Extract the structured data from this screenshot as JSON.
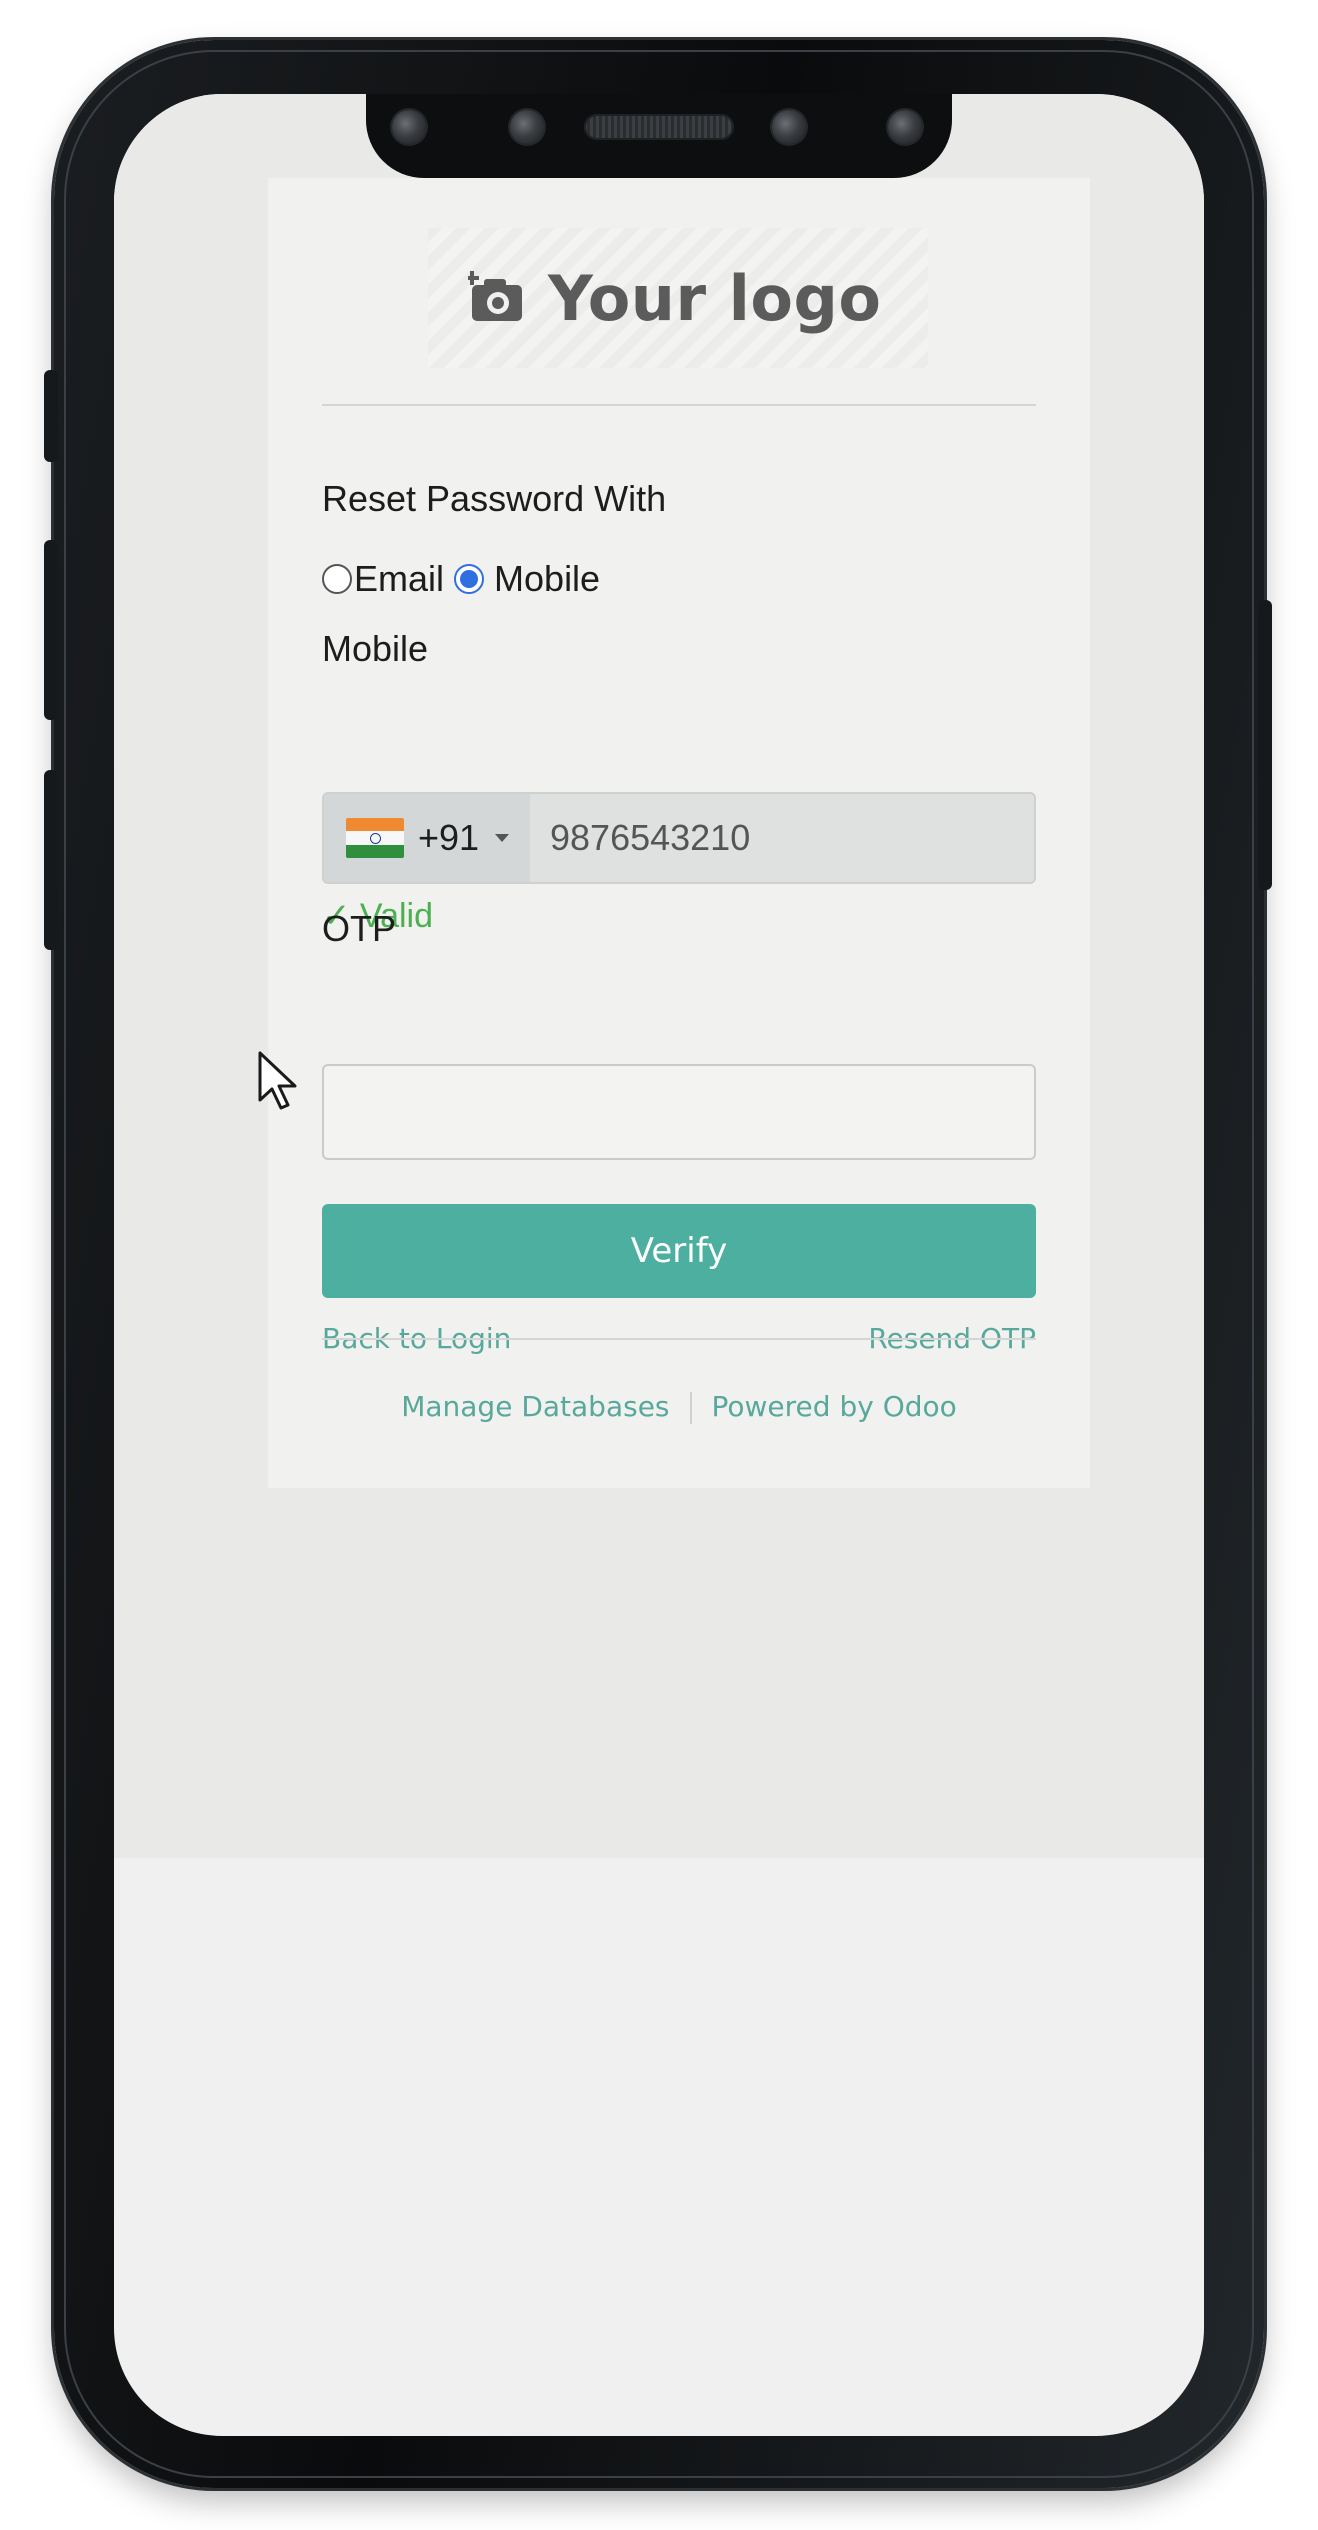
{
  "logo": {
    "text": "Your logo",
    "icon": "camera-icon"
  },
  "form": {
    "reset_label": "Reset Password With",
    "options": [
      {
        "label": "Email",
        "checked": false
      },
      {
        "label": "Mobile",
        "checked": true
      }
    ],
    "mobile_label": "Mobile",
    "country": {
      "flag": "india-flag-icon",
      "dial_code": "+91"
    },
    "mobile_value": "9876543210",
    "validation_text": "✓ Valid",
    "otp_label": "OTP",
    "otp_value": "",
    "verify_label": "Verify",
    "back_link": "Back to Login",
    "resend_link": "Resend OTP"
  },
  "footer": {
    "manage_databases": "Manage Databases",
    "powered_by": "Powered by Odoo"
  },
  "colors": {
    "accent": "#4caf9f",
    "link": "#58a89c",
    "valid": "#4caf50",
    "radio_checked": "#2f6fe0"
  }
}
